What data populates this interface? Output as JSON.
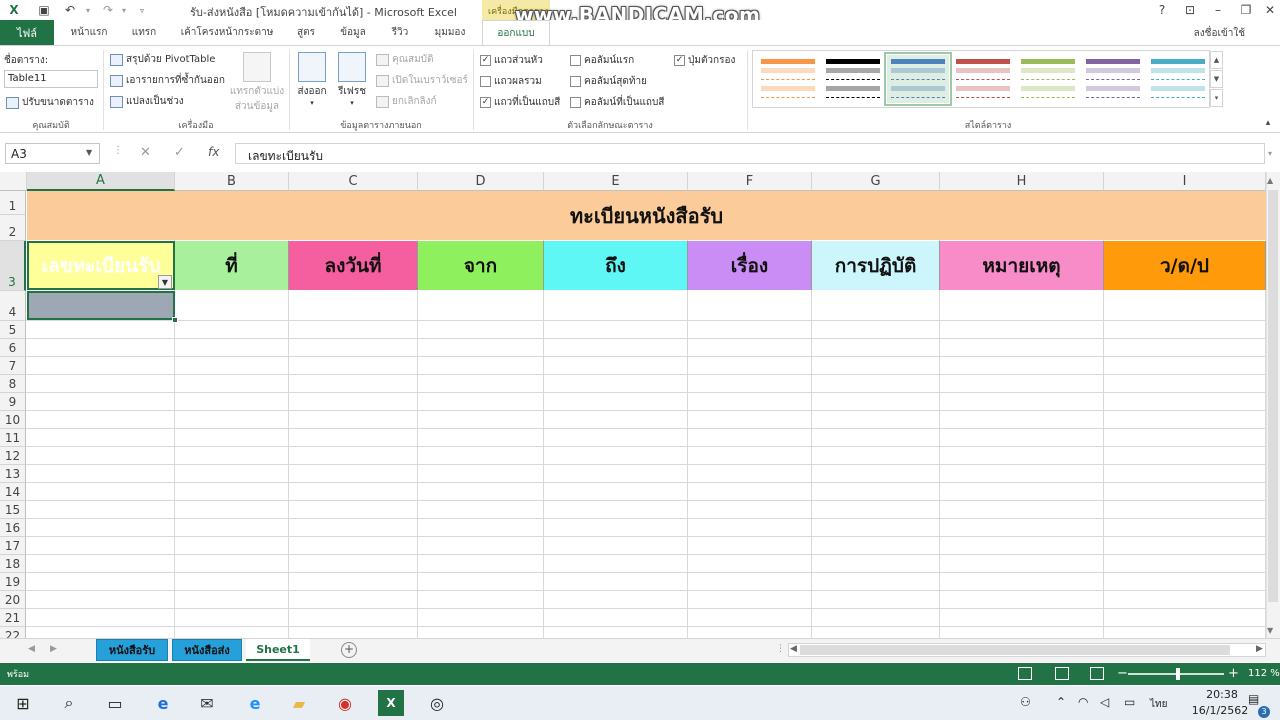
{
  "window": {
    "title": "รับ-ส่งหนังสือ  [โหมดความเข้ากันได้] - Microsoft Excel",
    "context_tab_group": "เครื่องมือตาราง",
    "watermark": "www.BANDICAM.com",
    "help": "?",
    "signin": "ลงชื่อเข้าใช้"
  },
  "ribbon_tabs": [
    {
      "label": "ไฟล์"
    },
    {
      "label": "หน้าแรก"
    },
    {
      "label": "แทรก"
    },
    {
      "label": "เค้าโครงหน้ากระดาษ"
    },
    {
      "label": "สูตร"
    },
    {
      "label": "ข้อมูล"
    },
    {
      "label": "รีวิว"
    },
    {
      "label": "มุมมอง"
    },
    {
      "label": "ออกแบบ"
    }
  ],
  "ribbon": {
    "properties": {
      "table_name_label": "ชื่อตาราง:",
      "table_name_value": "Table11",
      "resize_label": "ปรับขนาดตาราง",
      "group_label": "คุณสมบัติ"
    },
    "tools": {
      "pivot": "สรุปด้วย PivotTable",
      "remove_duplicates": "เอารายการที่ซ้ำกันออก",
      "convert_range": "แปลงเป็นช่วง",
      "slicer_line1": "แทรกตัวแบ่ง",
      "slicer_line2": "ส่วนข้อมูล",
      "group_label": "เครื่องมือ"
    },
    "external": {
      "export": "ส่งออก",
      "refresh": "รีเฟรช",
      "properties": "คุณสมบัติ",
      "open_browser": "เปิดในเบราว์เซอร์",
      "unlink": "ยกเลิกลิงก์",
      "group_label": "ข้อมูลตารางภายนอก"
    },
    "style_options": {
      "header_row": "แถวส่วนหัว",
      "total_row": "แถวผลรวม",
      "banded_rows": "แถวที่เป็นแถบสี",
      "first_column": "คอลัมน์แรก",
      "last_column": "คอลัมน์สุดท้าย",
      "banded_columns": "คอลัมน์ที่เป็นแถบสี",
      "filter_button": "ปุ่มตัวกรอง",
      "header_row_checked": true,
      "total_row_checked": false,
      "banded_rows_checked": true,
      "first_column_checked": false,
      "last_column_checked": false,
      "banded_columns_checked": false,
      "filter_button_checked": true,
      "group_label": "ตัวเลือกลักษณะตาราง"
    },
    "table_styles": {
      "group_label": "สไตล์ตาราง",
      "swatch_colors": [
        "#f79646",
        "#000000",
        "#4f81bd",
        "#c0504d",
        "#9bbb59",
        "#8064a2",
        "#4bacc6"
      ],
      "selected_index": 2
    }
  },
  "formula_bar": {
    "name_box": "A3",
    "fx": "fx",
    "cancel": "✕",
    "enter": "✓",
    "formula": "เลขทะเบียนรับ"
  },
  "grid": {
    "columns": [
      "A",
      "B",
      "C",
      "D",
      "E",
      "F",
      "G",
      "H",
      "I"
    ],
    "rows": [
      "1",
      "2",
      "3",
      "4",
      "5",
      "6",
      "7",
      "8",
      "9",
      "10",
      "11",
      "12",
      "13",
      "14",
      "15",
      "16",
      "17",
      "18",
      "19",
      "20",
      "21",
      "22"
    ],
    "banner": "ทะเบียนหนังสือรับ",
    "headers": [
      {
        "text": "เลขทะเบียนรับ",
        "color": "#ffff99"
      },
      {
        "text": "ที่",
        "color": "#a9f09c"
      },
      {
        "text": "ลงวันที่",
        "color": "#f55f9f"
      },
      {
        "text": "จาก",
        "color": "#8ef05d"
      },
      {
        "text": "ถึง",
        "color": "#5ff6f6"
      },
      {
        "text": "เรื่อง",
        "color": "#c98df5"
      },
      {
        "text": "การปฏิบัติ",
        "color": "#ccf6fc"
      },
      {
        "text": "หมายเหตุ",
        "color": "#f78cc8"
      },
      {
        "text": "ว/ด/ป",
        "color": "#ff9a0a"
      }
    ],
    "banner_color": "#fbcb99"
  },
  "sheets": [
    {
      "label": "หนังสือรับ",
      "active": false
    },
    {
      "label": "หนังสือส่ง",
      "active": false
    },
    {
      "label": "Sheet1",
      "active": true
    }
  ],
  "status": {
    "ready": "พร้อม",
    "zoom": "112 %"
  },
  "taskbar": {
    "language": "ไทย",
    "time": "20:38",
    "date": "16/1/2562",
    "notifications": "3"
  }
}
